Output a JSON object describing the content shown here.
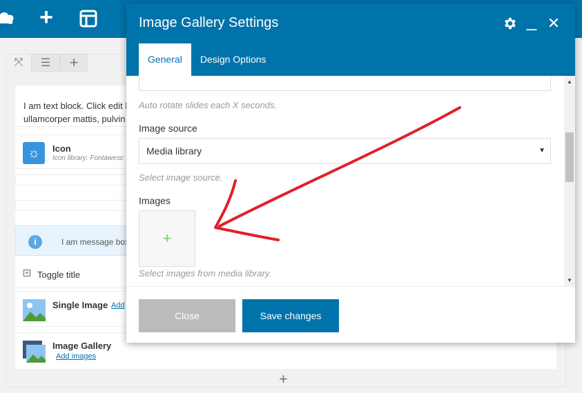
{
  "topbar": {
    "logo_icon": "cloud-logo-icon",
    "add_icon": "plus-icon",
    "layout_icon": "layout-icon"
  },
  "row_controls": {
    "expand_icon": "expand-icon",
    "drag_icon": "drag-handle-icon",
    "add_icon": "plus-icon"
  },
  "elements": {
    "text_block": {
      "text": "I am text block. Click edit b",
      "text2": "ullamcorper mattis, pulvin"
    },
    "icon": {
      "title": "Icon",
      "subtitle": "Icon library: Fontawesc"
    },
    "message": {
      "text": "I am message box"
    },
    "toggle": {
      "title": "Toggle title"
    },
    "single_image": {
      "title": "Single Image",
      "link": "Add"
    },
    "image_gallery": {
      "title": "Image Gallery",
      "link": "Add images"
    }
  },
  "modal": {
    "title": "Image Gallery Settings",
    "tabs": [
      {
        "label": "General",
        "active": true
      },
      {
        "label": "Design Options",
        "active": false
      }
    ],
    "fields": {
      "autorotate_help": "Auto rotate slides each X seconds.",
      "image_source_label": "Image source",
      "image_source_value": "Media library",
      "image_source_help": "Select image source.",
      "images_label": "Images",
      "images_help": "Select images from media library."
    },
    "buttons": {
      "close": "Close",
      "save": "Save changes"
    }
  },
  "colors": {
    "brand": "#0073aa",
    "annotation": "#e0202a"
  }
}
